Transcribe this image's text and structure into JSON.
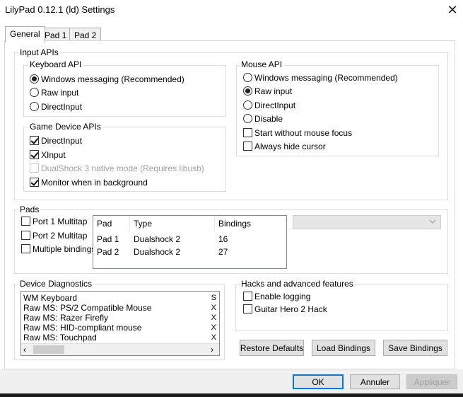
{
  "window": {
    "title": "LilyPad 0.12.1 (ld) Settings",
    "close_glyph": "✕"
  },
  "tabs": [
    {
      "label": "General",
      "active": true
    },
    {
      "label": "Pad 1",
      "active": false
    },
    {
      "label": "Pad 2",
      "active": false
    }
  ],
  "input_apis": {
    "title": "Input APIs",
    "keyboard": {
      "title": "Keyboard API",
      "options": [
        {
          "label": "Windows messaging (Recommended)",
          "selected": true
        },
        {
          "label": "Raw input",
          "selected": false
        },
        {
          "label": "DirectInput",
          "selected": false
        }
      ]
    },
    "game_device": {
      "title": "Game Device APIs",
      "options": [
        {
          "label": "DirectInput",
          "checked": true,
          "enabled": true
        },
        {
          "label": "XInput",
          "checked": true,
          "enabled": true
        },
        {
          "label": "DualShock 3 native mode (Requires libusb)",
          "checked": false,
          "enabled": false
        },
        {
          "label": "Monitor when in background",
          "checked": true,
          "enabled": true
        }
      ]
    },
    "mouse": {
      "title": "Mouse API",
      "options": [
        {
          "label": "Windows messaging (Recommended)",
          "selected": false
        },
        {
          "label": "Raw input",
          "selected": true
        },
        {
          "label": "DirectInput",
          "selected": false
        },
        {
          "label": "Disable",
          "selected": false
        }
      ],
      "checks": [
        {
          "label": "Start without mouse focus",
          "checked": false
        },
        {
          "label": "Always hide cursor",
          "checked": false
        }
      ]
    }
  },
  "pads": {
    "title": "Pads",
    "options": [
      {
        "label": "Port 1 Multitap",
        "checked": false
      },
      {
        "label": "Port 2 Multitap",
        "checked": false
      },
      {
        "label": "Multiple bindings",
        "checked": false
      }
    ],
    "table": {
      "columns": [
        "Pad",
        "Type",
        "Bindings"
      ],
      "rows": [
        [
          "Pad 1",
          "Dualshock 2",
          "16"
        ],
        [
          "Pad 2",
          "Dualshock 2",
          "27"
        ]
      ]
    },
    "combo_value": ""
  },
  "diagnostics": {
    "title": "Device Diagnostics",
    "items": [
      {
        "label": "WM Keyboard",
        "trail": "S"
      },
      {
        "label": "Raw MS: PS/2 Compatible Mouse",
        "trail": "X"
      },
      {
        "label": "Raw MS: Razer Firefly",
        "trail": "X"
      },
      {
        "label": "Raw MS: HID-compliant mouse",
        "trail": "X"
      },
      {
        "label": "Raw MS: Touchpad",
        "trail": "X"
      }
    ],
    "scroll_left": "‹",
    "scroll_right": "›"
  },
  "hacks": {
    "title": "Hacks and advanced features",
    "options": [
      {
        "label": "Enable logging",
        "checked": false
      },
      {
        "label": "Guitar Hero 2 Hack",
        "checked": false
      }
    ]
  },
  "actions": {
    "restore_defaults": "Restore Defaults",
    "load_bindings": "Load Bindings",
    "save_bindings": "Save Bindings"
  },
  "footer": {
    "ok": "OK",
    "cancel": "Annuler",
    "apply": "Appliquer"
  },
  "colors": {
    "accent": "#0078d7",
    "group_border": "#dcdcdc",
    "button_face": "#e1e1e1"
  },
  "icons": {
    "close": "close-icon",
    "dropdown": "chevron-down-icon"
  }
}
